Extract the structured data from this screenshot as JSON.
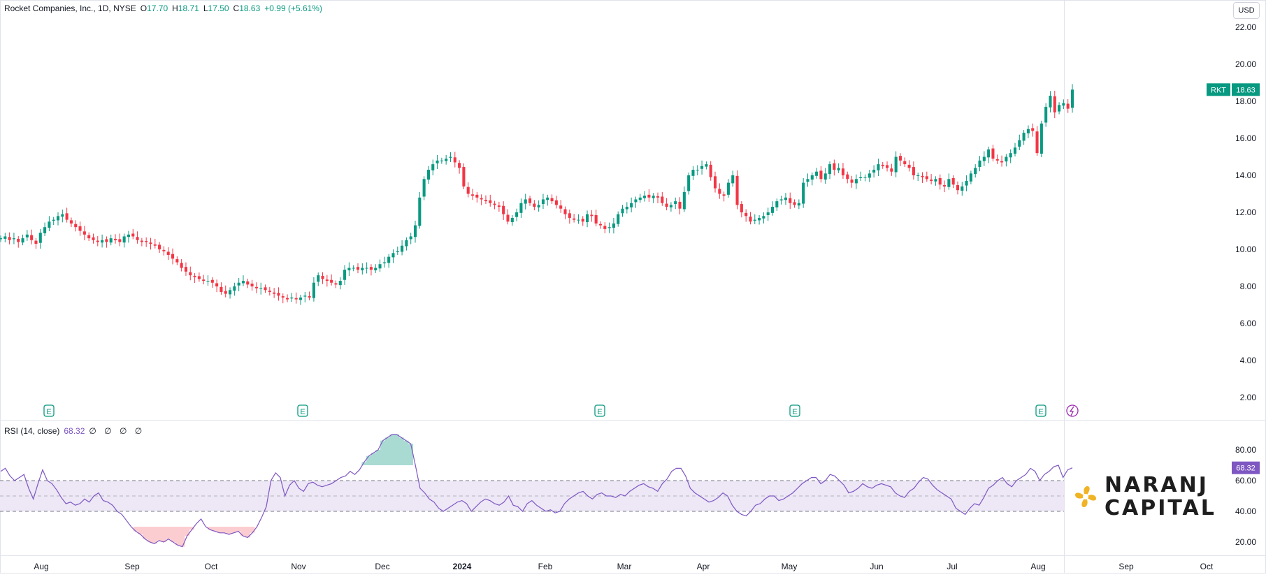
{
  "legend": {
    "symbol": "Rocket Companies, Inc., 1D, NYSE",
    "o_label": "O",
    "o": "17.70",
    "h_label": "H",
    "h": "18.71",
    "l_label": "L",
    "l": "17.50",
    "c_label": "C",
    "c": "18.63",
    "change": "+0.99 (+5.61%)"
  },
  "currency_button": "USD",
  "price_tag": {
    "ticker": "RKT",
    "value": "18.63"
  },
  "rsi_legend": {
    "label": "RSI (14, close)",
    "value": "68.32",
    "placeholders": "∅ ∅ ∅ ∅"
  },
  "rsi_tag": "68.32",
  "earnings_marker": "E",
  "brand": {
    "line1": "NARANJ",
    "line2": "CAPITAL"
  },
  "colors": {
    "up": "#089981",
    "down": "#f23645",
    "rsi": "#7e57c2",
    "band": "#ede7f6",
    "accent_gold": "#f0b323"
  },
  "chart_data": [
    {
      "type": "candlestick",
      "title": "Rocket Companies, Inc., 1D, NYSE",
      "ylim": [
        1.0,
        23.8
      ],
      "y_ticks": [
        "22.00",
        "20.00",
        "18.00",
        "16.00",
        "14.00",
        "12.00",
        "10.00",
        "8.00",
        "6.00",
        "4.00",
        "2.00"
      ],
      "x_ticks": [
        "Aug",
        "Sep",
        "Oct",
        "Nov",
        "Dec",
        "2024",
        "Feb",
        "Mar",
        "Apr",
        "May",
        "Jun",
        "Jul",
        "Aug",
        "Sep",
        "Oct"
      ],
      "close_series": [
        10.6,
        10.7,
        10.5,
        10.6,
        10.4,
        10.6,
        10.8,
        10.5,
        10.3,
        10.9,
        11.2,
        11.5,
        11.6,
        11.8,
        11.9,
        11.6,
        11.4,
        11.2,
        11.0,
        10.8,
        10.6,
        10.5,
        10.4,
        10.5,
        10.4,
        10.6,
        10.5,
        10.4,
        10.7,
        10.8,
        10.7,
        10.5,
        10.4,
        10.4,
        10.3,
        10.2,
        10.0,
        9.9,
        9.7,
        9.5,
        9.3,
        9.0,
        8.8,
        8.6,
        8.5,
        8.4,
        8.3,
        8.3,
        8.2,
        8.0,
        7.7,
        7.6,
        7.8,
        8.0,
        8.2,
        8.3,
        8.1,
        8.0,
        7.9,
        7.9,
        7.8,
        7.7,
        7.6,
        7.5,
        7.4,
        7.3,
        7.4,
        7.3,
        7.4,
        7.5,
        7.4,
        8.2,
        8.6,
        8.4,
        8.3,
        8.2,
        8.1,
        8.3,
        8.9,
        9.0,
        9.0,
        8.9,
        9.0,
        9.0,
        8.9,
        9.0,
        9.2,
        9.3,
        9.6,
        9.8,
        9.9,
        10.2,
        10.5,
        10.7,
        11.3,
        12.8,
        13.8,
        14.3,
        14.6,
        14.8,
        14.8,
        14.9,
        15.0,
        14.7,
        14.4,
        13.4,
        13.0,
        12.9,
        12.8,
        12.7,
        12.6,
        12.5,
        12.4,
        12.3,
        11.9,
        11.5,
        11.7,
        12.0,
        12.5,
        12.7,
        12.5,
        12.3,
        12.4,
        12.7,
        12.8,
        12.6,
        12.4,
        12.2,
        11.9,
        11.7,
        11.6,
        11.6,
        11.5,
        11.9,
        11.8,
        11.4,
        11.3,
        11.1,
        11.2,
        11.4,
        11.9,
        12.2,
        12.3,
        12.5,
        12.7,
        12.8,
        12.9,
        12.8,
        12.9,
        12.8,
        12.5,
        12.3,
        12.4,
        12.6,
        12.2,
        13.1,
        14.0,
        14.3,
        14.3,
        14.5,
        14.6,
        13.9,
        13.3,
        13.0,
        12.9,
        13.6,
        14.0,
        12.4,
        12.0,
        11.8,
        11.5,
        11.6,
        11.7,
        11.8,
        12.0,
        12.3,
        12.6,
        12.7,
        12.8,
        12.5,
        12.4,
        12.5,
        13.6,
        13.8,
        14.0,
        14.2,
        13.8,
        14.1,
        14.6,
        14.3,
        14.4,
        14.0,
        13.8,
        13.6,
        13.8,
        13.9,
        13.9,
        14.1,
        14.3,
        14.6,
        14.5,
        14.4,
        14.2,
        15.0,
        14.8,
        14.6,
        14.4,
        14.0,
        14.0,
        13.9,
        13.8,
        13.7,
        13.8,
        13.5,
        13.4,
        13.8,
        13.5,
        13.2,
        13.4,
        13.7,
        14.1,
        14.4,
        14.8,
        15.0,
        15.4,
        14.9,
        14.8,
        14.7,
        15.0,
        15.2,
        15.5,
        15.9,
        16.3,
        16.5,
        16.4,
        15.2,
        16.8,
        17.7,
        18.3,
        17.4,
        17.8,
        17.9,
        17.6,
        18.63
      ]
    },
    {
      "type": "line",
      "title": "RSI (14, close)",
      "ylim": [
        15,
        95
      ],
      "y_ticks": [
        "80.00",
        "60.00",
        "40.00",
        "20.00"
      ],
      "bands": [
        40,
        50,
        60
      ],
      "values": [
        66,
        68,
        63,
        60,
        62,
        64,
        55,
        48,
        58,
        67,
        60,
        58,
        54,
        49,
        45,
        46,
        44,
        45,
        48,
        46,
        50,
        52,
        47,
        46,
        44,
        40,
        38,
        34,
        30,
        27,
        25,
        22,
        20,
        19,
        21,
        20,
        22,
        20,
        18,
        17,
        24,
        28,
        32,
        35,
        30,
        28,
        27,
        26,
        26,
        25,
        26,
        27,
        24,
        23,
        26,
        30,
        36,
        43,
        60,
        65,
        62,
        50,
        57,
        60,
        55,
        53,
        58,
        59,
        57,
        56,
        57,
        58,
        60,
        62,
        63,
        66,
        64,
        67,
        72,
        76,
        78,
        80,
        86,
        88,
        90,
        90,
        88,
        86,
        84,
        70,
        55,
        52,
        48,
        46,
        42,
        40,
        42,
        44,
        46,
        47,
        45,
        40,
        43,
        46,
        48,
        47,
        45,
        44,
        46,
        50,
        44,
        43,
        40,
        45,
        47,
        44,
        42,
        40,
        41,
        39,
        40,
        45,
        48,
        50,
        52,
        53,
        50,
        48,
        51,
        52,
        50,
        50,
        49,
        51,
        50,
        53,
        55,
        57,
        58,
        56,
        55,
        53,
        58,
        61,
        66,
        68,
        68,
        63,
        55,
        52,
        50,
        48,
        46,
        47,
        49,
        52,
        50,
        44,
        40,
        38,
        37,
        40,
        44,
        45,
        48,
        50,
        50,
        47,
        48,
        50,
        52,
        55,
        58,
        60,
        62,
        62,
        58,
        60,
        64,
        63,
        60,
        57,
        52,
        53,
        55,
        58,
        56,
        55,
        57,
        58,
        57,
        56,
        52,
        50,
        49,
        53,
        55,
        59,
        62,
        61,
        57,
        54,
        52,
        50,
        48,
        42,
        40,
        38,
        42,
        45,
        44,
        49,
        55,
        57,
        60,
        62,
        58,
        56,
        60,
        62,
        64,
        68,
        66,
        60,
        64,
        66,
        69,
        70,
        62,
        67,
        68.32
      ]
    }
  ]
}
